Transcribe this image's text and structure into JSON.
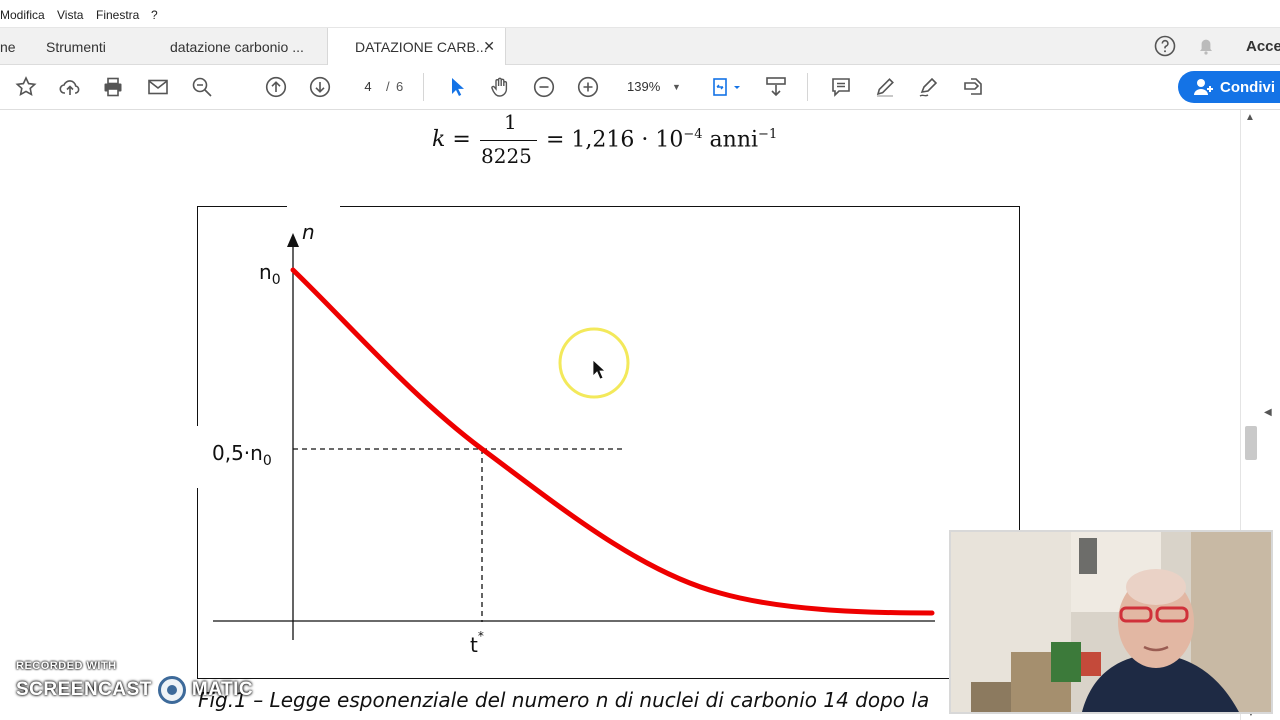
{
  "menubar": {
    "items": [
      "Modifica",
      "Vista",
      "Finestra",
      "?"
    ]
  },
  "tabs": {
    "home_partial": "ne",
    "tools": "Strumenti",
    "doc1": "datazione carbonio ...",
    "doc2": "DATAZIONE CARB...",
    "close": "✕",
    "account": "Acce"
  },
  "toolbar": {
    "page_current": "4",
    "page_separator": "/",
    "page_total": "6",
    "zoom": "139%",
    "share_label": "Condivi",
    "accent_color": "#1473e6"
  },
  "document": {
    "formula": {
      "lhs": "k =",
      "numerator": "1",
      "denominator": "8225",
      "rhs_prefix": "= 1,216 · 10",
      "rhs_exp": "−4",
      "unit": " anni",
      "unit_exp": "−1"
    },
    "graph": {
      "y_axis_label": "n",
      "y_top_label": "n",
      "y_top_label_sub": "0",
      "y_half_label": "0,5·n",
      "y_half_label_sub": "0",
      "x_marker_label": "t",
      "x_marker_sup": "*",
      "curve_color": "#ee0000"
    },
    "caption": "Fig.1 – Legge esponenziale del numero n di nuclei di carbonio 14 dopo la"
  },
  "watermark": {
    "recorded": "RECORDED WITH",
    "brand_left": "SCREENCAST",
    "brand_right": "MATIC"
  }
}
